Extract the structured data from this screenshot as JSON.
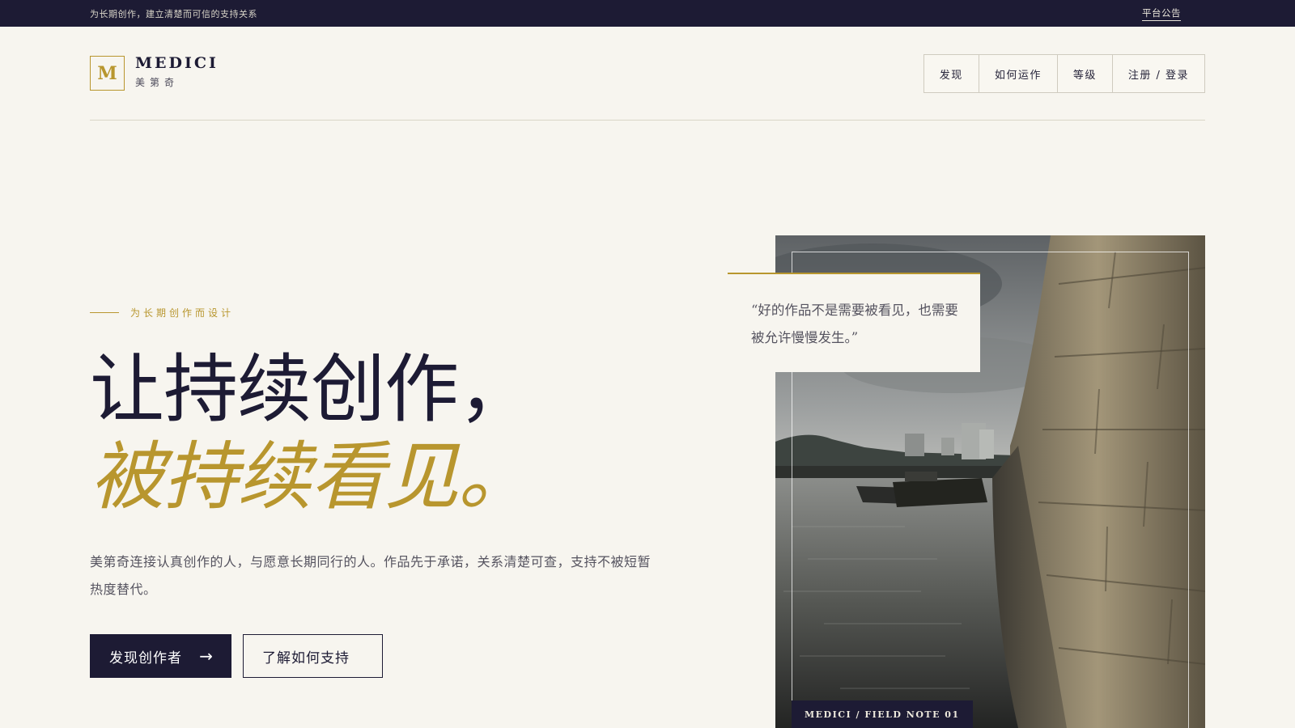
{
  "topbar": {
    "tagline": "为长期创作，建立清楚而可信的支持关系",
    "notice": "平台公告"
  },
  "brand": {
    "mark": "M",
    "name_en": "MEDICI",
    "name_cn": "美第奇"
  },
  "nav": {
    "items": [
      {
        "label": "发现"
      },
      {
        "label": "如何运作"
      },
      {
        "label": "等级"
      },
      {
        "label": "注册 / 登录"
      }
    ]
  },
  "hero": {
    "eyebrow": "为长期创作而设计",
    "headline_line1": "让持续创作，",
    "headline_line2": "被持续看见。",
    "description": "美第奇连接认真创作的人，与愿意长期同行的人。作品先于承诺，关系清楚可查，支持不被短暂热度替代。",
    "primary_cta": "发现创作者",
    "primary_cta_icon": "arrow-right-icon",
    "secondary_cta": "了解如何支持",
    "quote": "“好的作品不是需要被看见，也需要被允许慢慢发生。”",
    "photo_caption": "MEDICI / FIELD NOTE 01"
  },
  "colors": {
    "navy": "#1d1b34",
    "gold": "#b8962e",
    "background": "#f7f5ef"
  }
}
